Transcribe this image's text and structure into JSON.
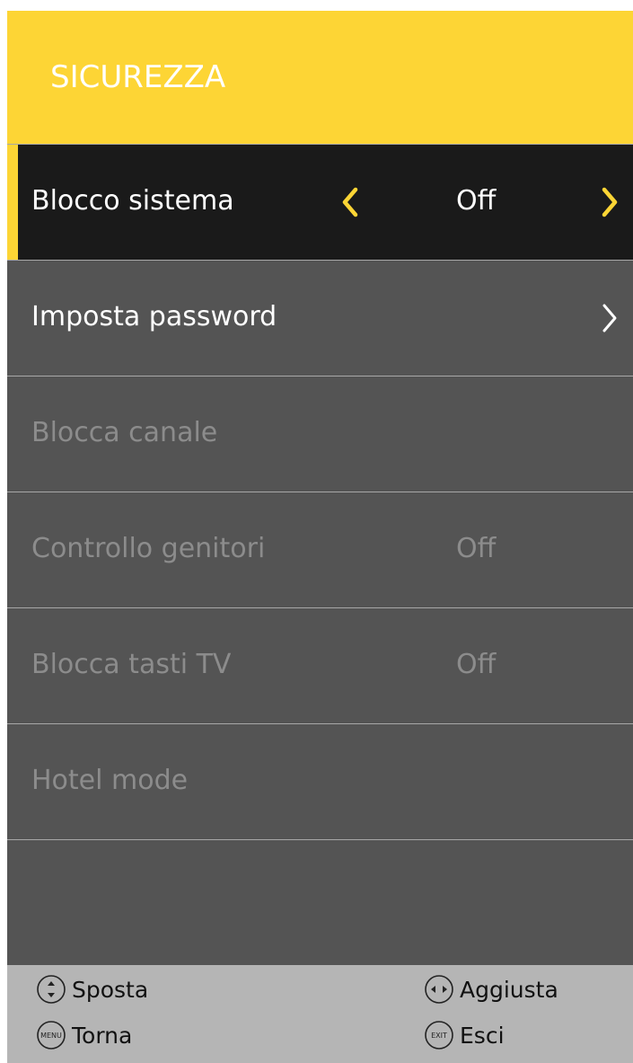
{
  "header": {
    "title": "SICUREZZA"
  },
  "menu": {
    "items": [
      {
        "label": "Blocco sistema",
        "value": "Off"
      },
      {
        "label": "Imposta password",
        "value": ""
      },
      {
        "label": "Blocca canale",
        "value": ""
      },
      {
        "label": "Controllo genitori",
        "value": "Off"
      },
      {
        "label": "Blocca tasti TV",
        "value": "Off"
      },
      {
        "label": "Hotel mode",
        "value": ""
      }
    ]
  },
  "footer": {
    "move_label": "Sposta",
    "adjust_label": "Aggiusta",
    "back_label": "Torna",
    "exit_label": "Esci",
    "menu_key_text": "MENU",
    "exit_key_text": "EXIT"
  },
  "colors": {
    "accent": "#fdd535",
    "panel": "#545454",
    "selected_row": "#1a1a1a",
    "footer": "#b5b5b5",
    "disabled_text": "#8c8c8c"
  },
  "icons": {
    "left_arrow": "chevron-left-icon",
    "right_arrow": "chevron-right-icon",
    "move": "up-down-nav-icon",
    "adjust": "left-right-nav-icon",
    "menu_key": "menu-key-icon",
    "exit_key": "exit-key-icon"
  }
}
